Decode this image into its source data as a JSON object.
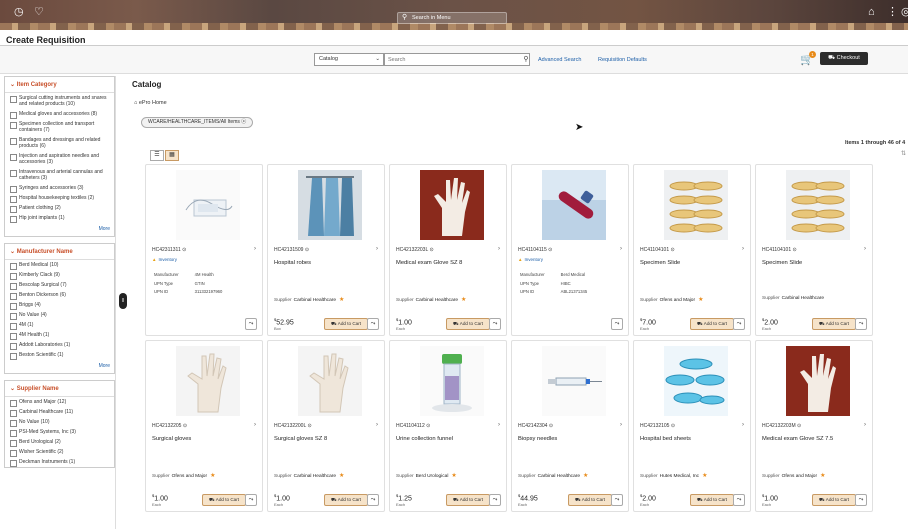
{
  "topbar": {
    "search_placeholder": "Search in Menu"
  },
  "page": {
    "title": "Create Requisition"
  },
  "searchbar": {
    "catalog_value": "Catalog",
    "search_placeholder": "Search",
    "advanced_search": "Advanced Search",
    "requisition_defaults": "Requisition Defaults",
    "cart_count": "1",
    "checkout_label": "Checkout"
  },
  "sidebar": {
    "facets": [
      {
        "title": "Item Category",
        "more": "More",
        "items": [
          "Surgical cutting instruments and snares and related products (10)",
          "Medical gloves and accessories (8)",
          "Specimen collection and transport containers (7)",
          "Bandages and dressings and related products (6)",
          "Injection and aspiration needles and accessories (3)",
          "Intravenous and arterial cannulas and catheters (3)",
          "Syringes and accessories (3)",
          "Hospital housekeeping textiles (2)",
          "Patient clothing (2)",
          "Hip joint implants (1)"
        ]
      },
      {
        "title": "Manufacturer Name",
        "more": "More",
        "items": [
          "Berd Medical (10)",
          "Kimberly Clack (9)",
          "Bescolap Surgical (7)",
          "Benton Dickerson (6)",
          "Briggs (4)",
          "No Value (4)",
          "4M (1)",
          "4M Health (1)",
          "Addott Laboratories (1)",
          "Beston Scientific (1)"
        ]
      },
      {
        "title": "Supplier Name",
        "more": "",
        "items": [
          "Ofens and Major (12)",
          "Carbinal Healthcare (11)",
          "No Value (10)",
          "PSI-Med Systems, Inc (3)",
          "Berd Urological (2)",
          "Wisher Scientific (2)",
          "Deckman Instruments (1)"
        ]
      }
    ]
  },
  "main": {
    "heading": "Catalog",
    "home_label": "ePro Home",
    "chip": "WCARE/HEALTHCARE_ITEMS/All Items",
    "items_count": "Items 1 through 46 of 4",
    "add_to_cart": "Add to Cart",
    "supplier_label": "Supplier",
    "inventory_label": "Inventory"
  },
  "products": [
    {
      "id": "HC42311311",
      "name": "",
      "inventory": true,
      "specs": [
        [
          "Manufacturer",
          "4M Health"
        ],
        [
          "UPN Type",
          "GTIN"
        ],
        [
          "UPN ID",
          "311332197960"
        ]
      ],
      "supplier": "",
      "price": "",
      "unit": "",
      "img": "gauze",
      "star": false
    },
    {
      "id": "HC42131509",
      "name": "Hospital robes",
      "inventory": false,
      "specs": [],
      "supplier": "Carbinal Healthcare",
      "price": "52.95",
      "unit": "Box",
      "img": "robes",
      "star": true
    },
    {
      "id": "HC42132203L",
      "name": "Medical exam Glove SZ 8",
      "inventory": false,
      "specs": [],
      "supplier": "Carbinal Healthcare",
      "price": "1.00",
      "unit": "Each",
      "img": "glove-red",
      "star": true
    },
    {
      "id": "HC41104115",
      "name": "",
      "inventory": true,
      "specs": [
        [
          "Manufacturer",
          "Berd Medical"
        ],
        [
          "UPN Type",
          "HIBC"
        ],
        [
          "UPN ID",
          "ABL21371345"
        ]
      ],
      "supplier": "",
      "price": "",
      "unit": "",
      "img": "tube",
      "star": false
    },
    {
      "id": "HC41104101",
      "name": "Specimen Slide",
      "inventory": false,
      "specs": [],
      "supplier": "Ofens and Major",
      "price": "7.00",
      "unit": "Each",
      "img": "petri",
      "star": true
    },
    {
      "id": "HC41104101",
      "name": "Specimen Slide",
      "inventory": false,
      "specs": [],
      "supplier": "Carbinal Healthcare",
      "price": "2.00",
      "unit": "Each",
      "img": "petri",
      "star": false
    },
    {
      "id": "HC42132205",
      "name": "Surgical gloves",
      "inventory": false,
      "specs": [],
      "supplier": "Ofens and Major",
      "price": "1.00",
      "unit": "Each",
      "img": "glove-white",
      "star": true
    },
    {
      "id": "HC42132200L",
      "name": "Surgical gloves SZ 8",
      "inventory": false,
      "specs": [],
      "supplier": "Carbinal Healthcare",
      "price": "1.00",
      "unit": "Each",
      "img": "glove-white",
      "star": true
    },
    {
      "id": "HC41104112",
      "name": "Urine collection funnel",
      "inventory": false,
      "specs": [],
      "supplier": "Berd Urological",
      "price": "1.25",
      "unit": "Each",
      "img": "funnel",
      "star": true
    },
    {
      "id": "HC42142304",
      "name": "Biopsy needles",
      "inventory": false,
      "specs": [],
      "supplier": "Carbinal Healthcare",
      "price": "44.95",
      "unit": "Each",
      "img": "syringe",
      "star": true
    },
    {
      "id": "HC42132105",
      "name": "Hospital bed sheets",
      "inventory": false,
      "specs": [],
      "supplier": "Hutes Medical, Inc",
      "price": "2.00",
      "unit": "Each",
      "img": "dishes",
      "star": true
    },
    {
      "id": "HC42132203M",
      "name": "Medical exam Glove SZ 7.5",
      "inventory": false,
      "specs": [],
      "supplier": "Ofens and Major",
      "price": "1.00",
      "unit": "Each",
      "img": "glove-red",
      "star": true
    }
  ]
}
